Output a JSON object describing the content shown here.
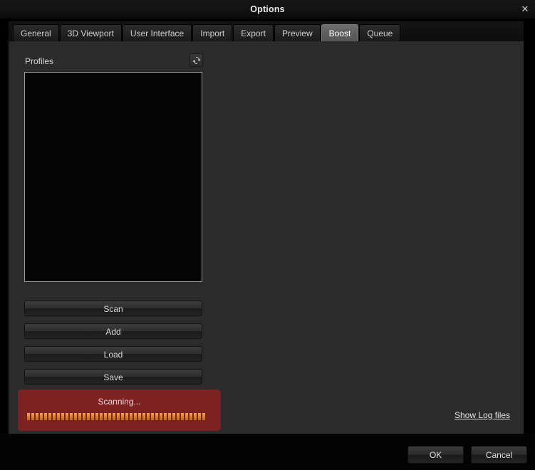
{
  "window": {
    "title": "Options",
    "close_label": "✕"
  },
  "tabs": [
    {
      "label": "General",
      "active": false
    },
    {
      "label": "3D Viewport",
      "active": false
    },
    {
      "label": "User Interface",
      "active": false
    },
    {
      "label": "Import",
      "active": false
    },
    {
      "label": "Export",
      "active": false
    },
    {
      "label": "Preview",
      "active": false
    },
    {
      "label": "Boost",
      "active": true
    },
    {
      "label": "Queue",
      "active": false
    }
  ],
  "boost_panel": {
    "profiles_label": "Profiles",
    "refresh_icon": "refresh-icon",
    "profiles_list_items": [],
    "buttons": {
      "scan": "Scan",
      "add": "Add",
      "load": "Load",
      "save": "Save"
    },
    "status": {
      "text": "Scanning...",
      "progress_segments": 42,
      "panel_color": "#7d2222",
      "segment_color": "#d9822b"
    },
    "log_link": "Show Log files"
  },
  "footer": {
    "ok_label": "OK",
    "cancel_label": "Cancel"
  }
}
